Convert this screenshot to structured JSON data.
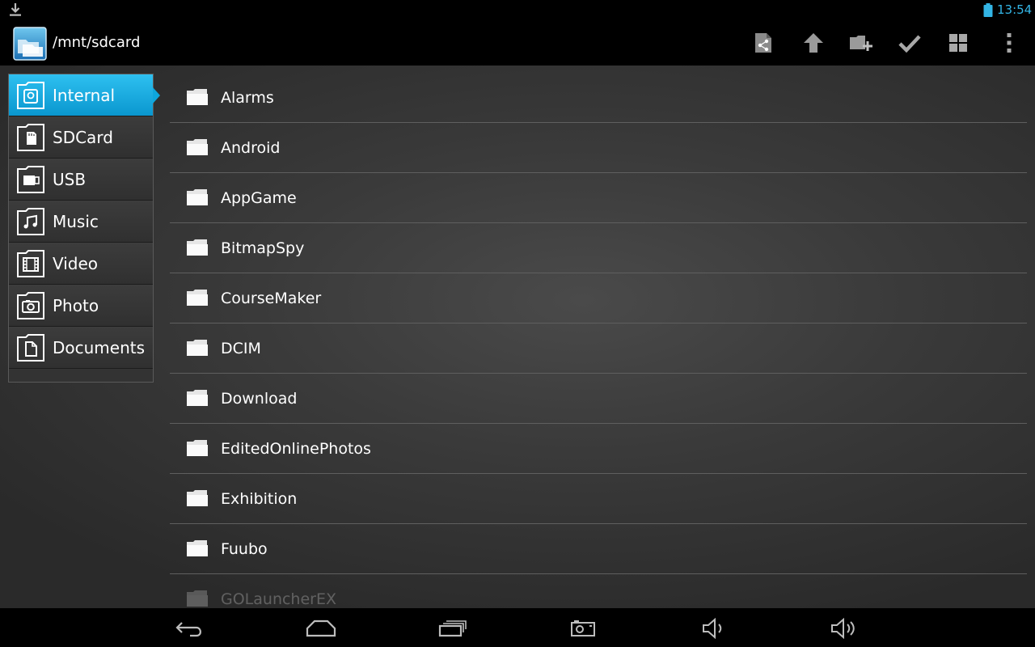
{
  "status_bar": {
    "time": "13:54",
    "icons": [
      "download-icon",
      "battery-icon"
    ],
    "accent_color": "#33b5e5"
  },
  "action_bar": {
    "path": "/mnt/sdcard",
    "app_icon": "file-manager-icon",
    "actions": [
      "share-icon",
      "up-arrow-icon",
      "new-folder-icon",
      "checkmark-icon",
      "grid-view-icon",
      "overflow-menu-icon"
    ]
  },
  "sidebar": {
    "items": [
      {
        "label": "Internal",
        "icon": "internal-storage-icon",
        "active": true
      },
      {
        "label": "SDCard",
        "icon": "sdcard-icon",
        "active": false
      },
      {
        "label": "USB",
        "icon": "usb-icon",
        "active": false
      },
      {
        "label": "Music",
        "icon": "music-note-icon",
        "active": false
      },
      {
        "label": "Video",
        "icon": "film-icon",
        "active": false
      },
      {
        "label": "Photo",
        "icon": "camera-icon",
        "active": false
      },
      {
        "label": "Documents",
        "icon": "document-icon",
        "active": false
      }
    ],
    "active_color": "#1aa9e0"
  },
  "files": [
    {
      "name": "Alarms"
    },
    {
      "name": "Android"
    },
    {
      "name": "AppGame"
    },
    {
      "name": "BitmapSpy"
    },
    {
      "name": "CourseMaker"
    },
    {
      "name": "DCIM"
    },
    {
      "name": "Download"
    },
    {
      "name": "EditedOnlinePhotos"
    },
    {
      "name": "Exhibition"
    },
    {
      "name": "Fuubo"
    },
    {
      "name": "GOLauncherEX"
    }
  ],
  "nav_bar": {
    "buttons": [
      "back-icon",
      "home-icon",
      "recent-apps-icon",
      "screenshot-icon",
      "volume-down-icon",
      "volume-up-icon"
    ]
  }
}
